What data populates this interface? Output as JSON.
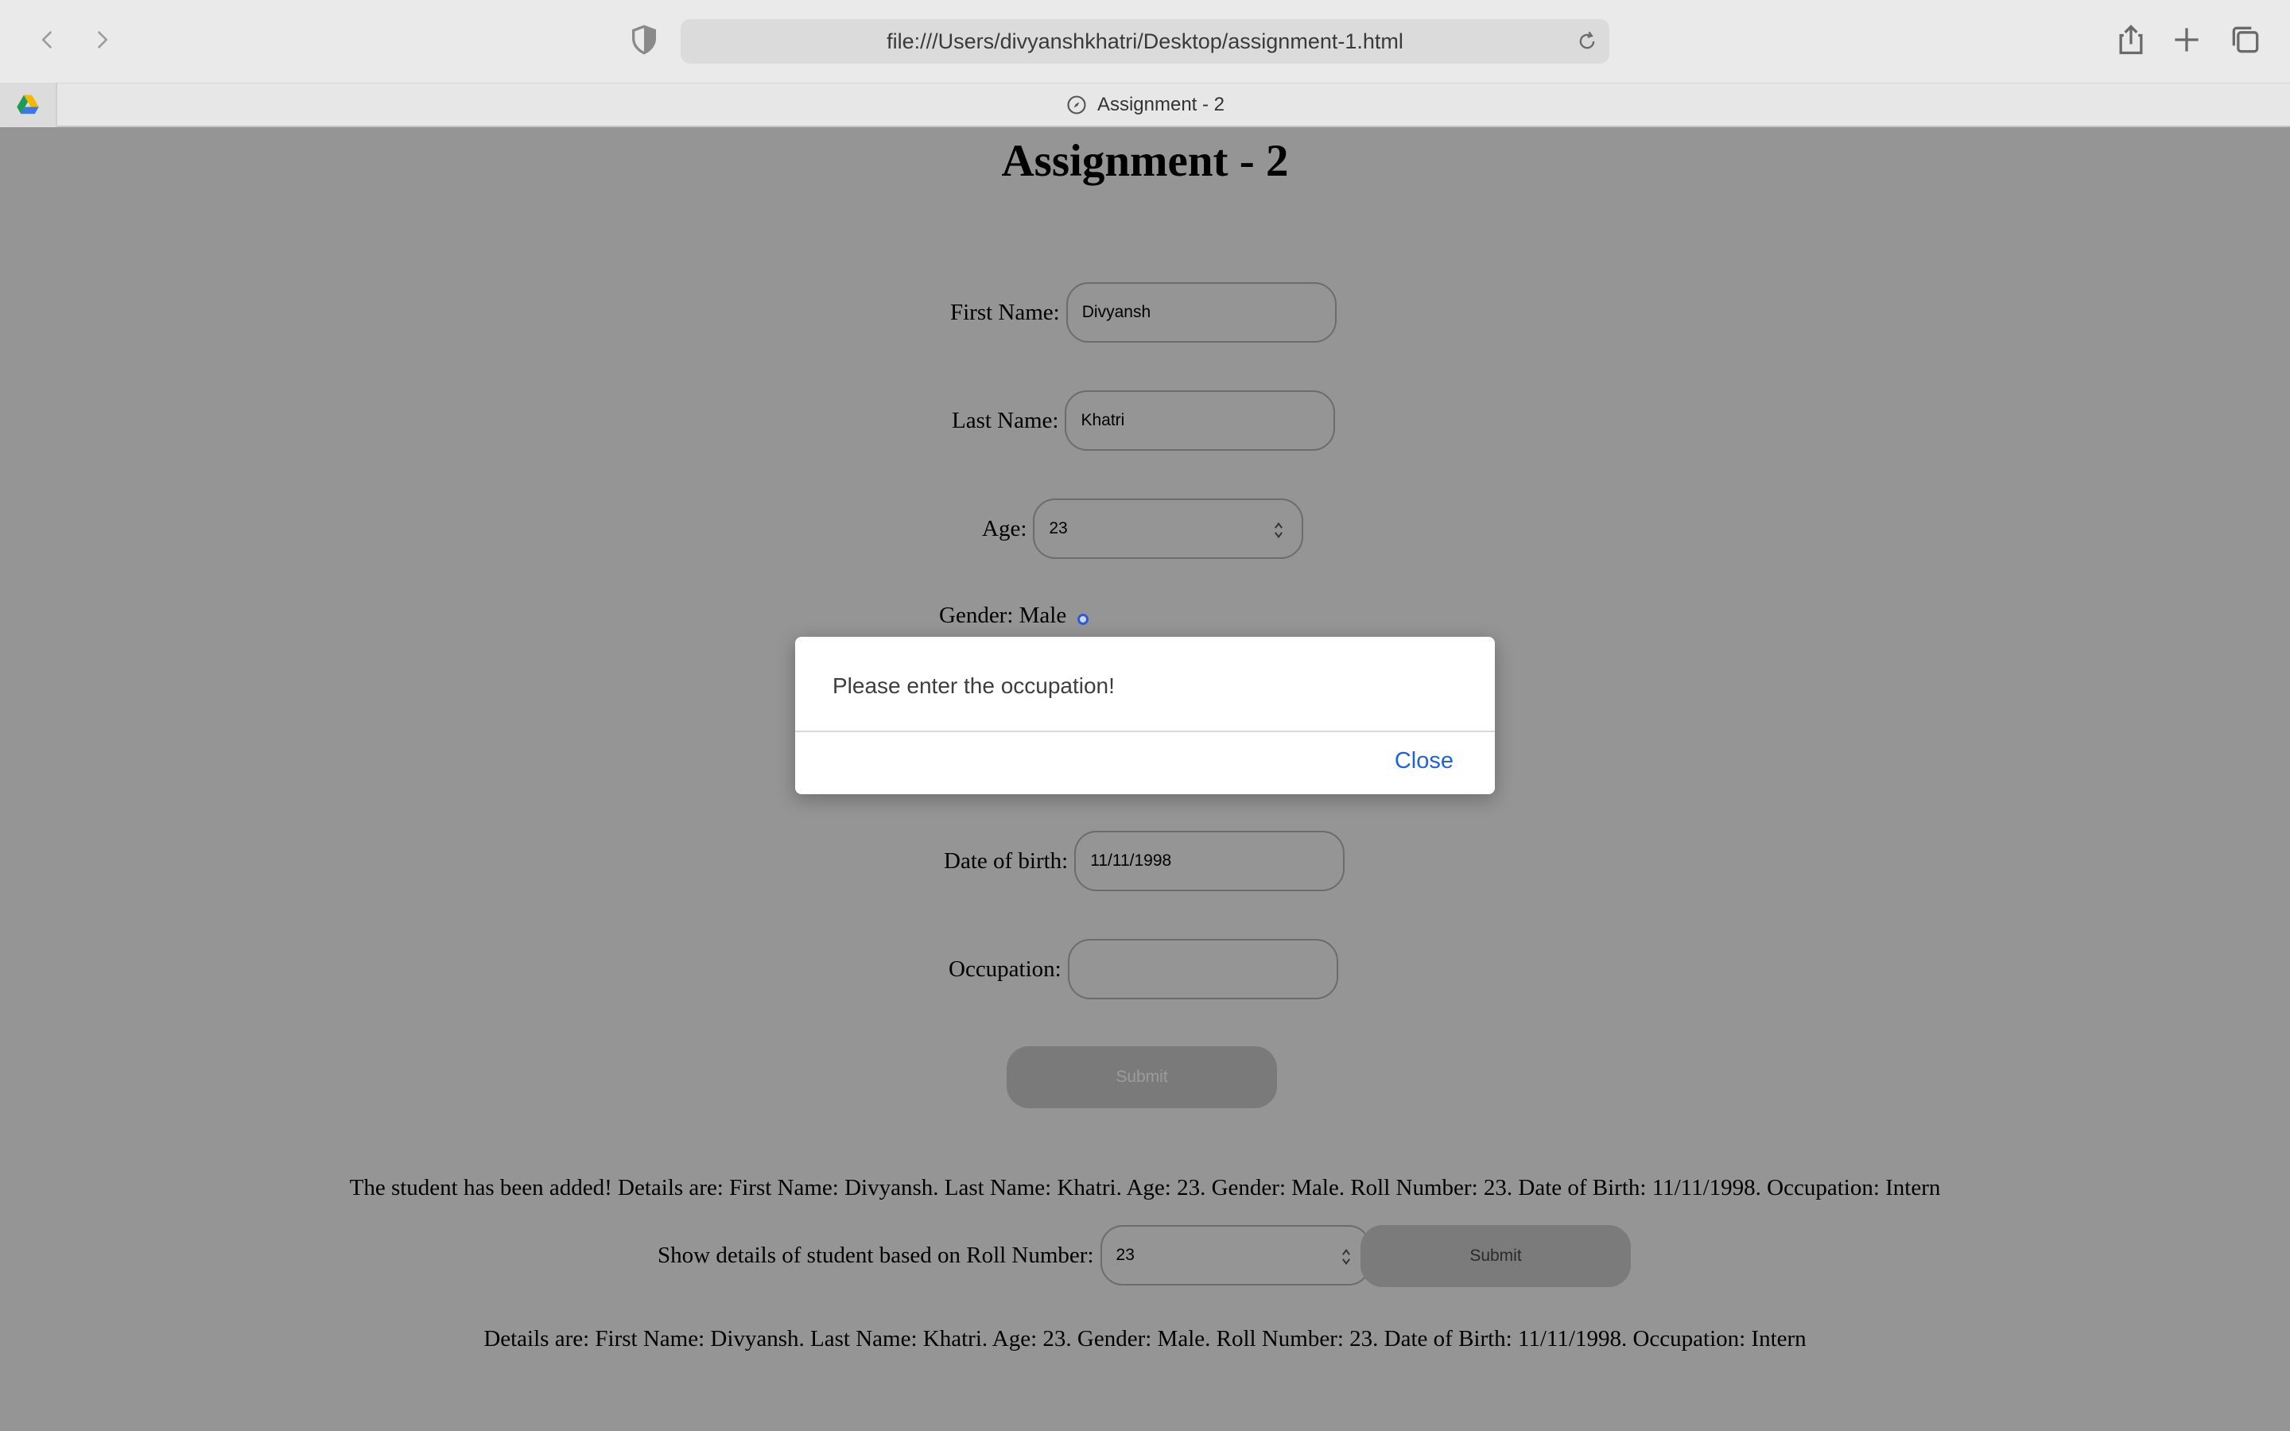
{
  "browser": {
    "url": "file:///Users/divyanshkhatri/Desktop/assignment-1.html",
    "tab_title": "Assignment - 2"
  },
  "page": {
    "title": "Assignment - 2",
    "first_name": {
      "label": "First Name:",
      "value": "Divyansh"
    },
    "last_name": {
      "label": "Last Name:",
      "value": "Khatri"
    },
    "age": {
      "label": "Age:",
      "value": "23"
    },
    "gender": {
      "label": "Gender: Male"
    },
    "dob": {
      "label": "Date of birth:",
      "value": "11/11/1998"
    },
    "occupation": {
      "label": "Occupation:",
      "value": ""
    },
    "submit_label": "Submit",
    "added_message": "The student has been added! Details are: First Name: Divyansh. Last Name: Khatri. Age: 23. Gender: Male. Roll Number: 23. Date of Birth: 11/11/1998. Occupation: Intern",
    "roll_lookup": {
      "label": "Show details of student based on Roll Number:",
      "value": "23",
      "submit_label": "Submit"
    },
    "details_message": "Details are: First Name: Divyansh. Last Name: Khatri. Age: 23. Gender: Male. Roll Number: 23. Date of Birth: 11/11/1998. Occupation: Intern"
  },
  "dialog": {
    "message": "Please enter the occupation!",
    "close_label": "Close"
  },
  "colors": {
    "overlay_background": "#959595",
    "dialog_link": "#1f62e0"
  }
}
